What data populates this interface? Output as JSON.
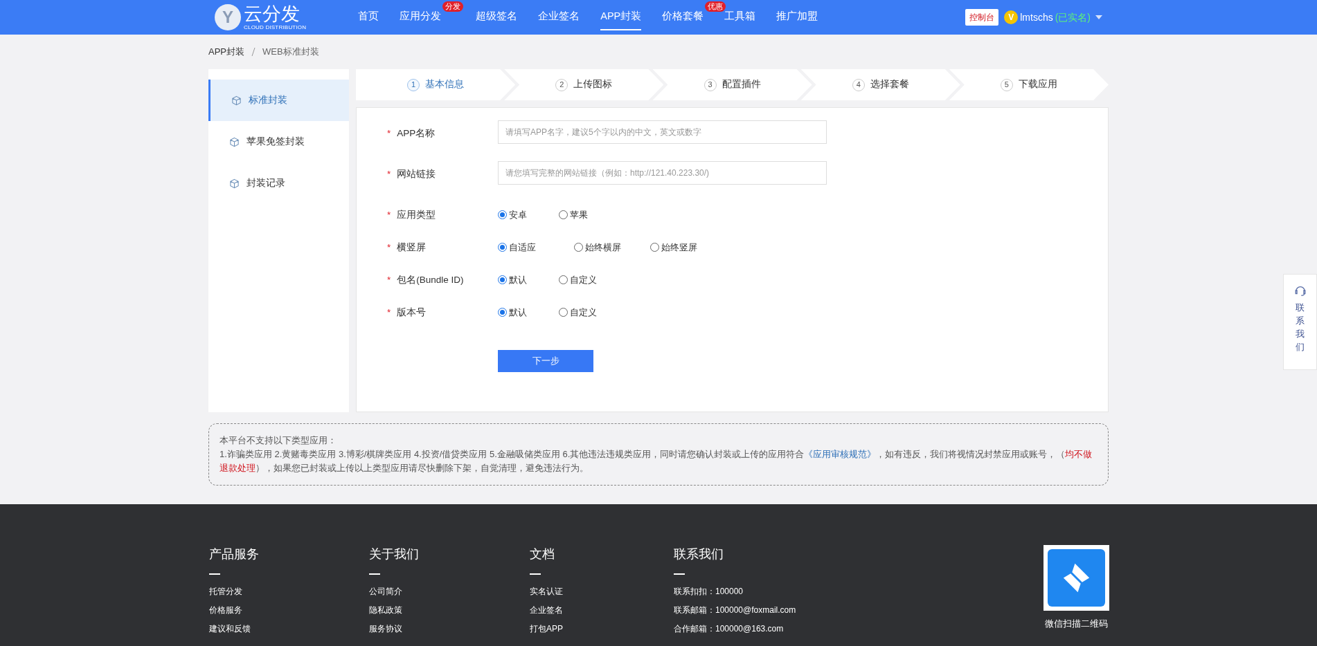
{
  "header": {
    "logo": {
      "letter": "Y",
      "title": "云分发",
      "subtitle": "CLOUD DISTRIBUTION"
    },
    "nav": [
      {
        "label": "首页",
        "selected": false
      },
      {
        "label": "应用分发",
        "selected": false,
        "badge": "分发"
      },
      {
        "label": "超级签名",
        "selected": false
      },
      {
        "label": "企业签名",
        "selected": false
      },
      {
        "label": "APP封装",
        "selected": true
      },
      {
        "label": "价格套餐",
        "selected": false,
        "badge": "优惠"
      },
      {
        "label": "工具箱",
        "selected": false
      },
      {
        "label": "推广加盟",
        "selected": false
      }
    ],
    "console": "控制台",
    "user": {
      "avatar": "V",
      "name": "lmtschs",
      "status": "(已实名)"
    }
  },
  "breadcrumb": [
    "APP封装",
    "WEB标准封装"
  ],
  "sidebar": {
    "items": [
      {
        "label": "标准封装",
        "selected": true
      },
      {
        "label": "苹果免签封装",
        "selected": false
      },
      {
        "label": "封装记录",
        "selected": false
      }
    ]
  },
  "steps": [
    {
      "number": "1",
      "label": "基本信息",
      "selected": true
    },
    {
      "number": "2",
      "label": "上传图标",
      "selected": false
    },
    {
      "number": "3",
      "label": "配置插件",
      "selected": false
    },
    {
      "number": "4",
      "label": "选择套餐",
      "selected": false
    },
    {
      "number": "5",
      "label": "下载应用",
      "selected": false
    }
  ],
  "form": {
    "fields": [
      {
        "kind": "input",
        "required": "*",
        "label": "APP名称",
        "placeholder": "请填写APP名字，建议5个字以内的中文，英文或数字"
      },
      {
        "kind": "input",
        "required": "*",
        "label": "网站链接",
        "placeholder": "请您填写完整的网站链接（例如：http://121.40.223.30/)"
      },
      {
        "kind": "radio",
        "required": "*",
        "label": "应用类型",
        "options": [
          {
            "label": "安卓",
            "selected": true
          },
          {
            "label": "苹果",
            "selected": false
          }
        ]
      },
      {
        "kind": "radio",
        "required": "*",
        "label": "横竖屏",
        "options": [
          {
            "label": "自适应",
            "selected": true
          },
          {
            "label": "始终横屏",
            "selected": false
          },
          {
            "label": "始终竖屏",
            "selected": false
          }
        ]
      },
      {
        "kind": "radio",
        "required": "*",
        "label": "包名(Bundle ID)",
        "options": [
          {
            "label": "默认",
            "selected": true
          },
          {
            "label": "自定义",
            "selected": false
          }
        ]
      },
      {
        "kind": "radio",
        "required": "*",
        "label": "版本号",
        "options": [
          {
            "label": "默认",
            "selected": true
          },
          {
            "label": "自定义",
            "selected": false
          }
        ]
      }
    ],
    "submit": "下一步"
  },
  "notice": {
    "title": "本平台不支持以下类型应用：",
    "body": [
      {
        "kind": "text",
        "text": "1.诈骗类应用 2.黄赌毒类应用 3.博彩/棋牌类应用 4.投资/借贷类应用 5.金融吸储类应用 6.其他违法违规类应用，同时请您确认封装或上传的应用符合"
      },
      {
        "kind": "link",
        "text": "《应用审核规范》"
      },
      {
        "kind": "text",
        "text": "，如有违反，我们将视情况封禁应用或账号，（"
      },
      {
        "kind": "warning",
        "text": "均不做退款处理"
      },
      {
        "kind": "text",
        "text": "），如果您已封装或上传以上类型应用请尽快删除下架，自觉清理，避免违法行为。"
      }
    ]
  },
  "contact_float": "联系我们",
  "footer": {
    "columns": [
      {
        "title": "产品服务",
        "links": [
          "托管分发",
          "价格服务",
          "建议和反馈"
        ]
      },
      {
        "title": "关于我们",
        "links": [
          "公司简介",
          "隐私政策",
          "服务协议"
        ]
      },
      {
        "title": "文档",
        "links": [
          "实名认证",
          "企业签名",
          "打包APP"
        ]
      },
      {
        "title": "联系我们",
        "links": [
          "联系扣扣：100000",
          "联系邮箱：100000@foxmail.com",
          "合作邮箱：100000@163.com"
        ]
      }
    ],
    "qr_caption": "微信扫描二维码"
  }
}
